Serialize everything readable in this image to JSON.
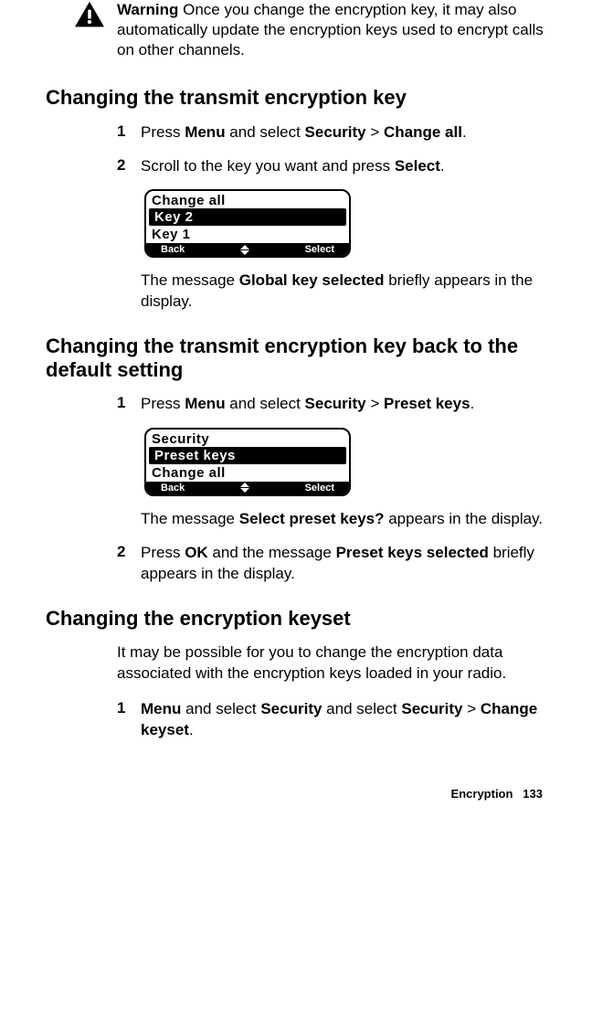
{
  "warning": {
    "label": "Warning",
    "text": "Once you change the encryption key, it may also automatically update the encryption keys used to encrypt calls on other channels."
  },
  "section1": {
    "heading": "Changing the transmit encryption key",
    "step1": {
      "num": "1",
      "prefix": "Press ",
      "b1": "Menu",
      "mid": " and select ",
      "b2": "Security",
      "sep": " > ",
      "b3": "Change all",
      "suffix": "."
    },
    "step2": {
      "num": "2",
      "prefix": "Scroll to the key you want and press ",
      "b1": "Select",
      "suffix": "."
    },
    "lcd": {
      "title": "Change all",
      "row_hi": "Key 2",
      "row2": "Key 1",
      "left": "Back",
      "right": "Select"
    },
    "result_pre": "The message ",
    "result_b": "Global key selected",
    "result_post": " briefly appears in the display."
  },
  "section2": {
    "heading": "Changing the transmit encryption key back to the default setting",
    "step1": {
      "num": "1",
      "prefix": "Press ",
      "b1": "Menu",
      "mid": " and select ",
      "b2": "Security",
      "sep": " > ",
      "b3": "Preset keys",
      "suffix": "."
    },
    "lcd": {
      "title": "Security",
      "row_hi": "Preset keys",
      "row2": "Change all",
      "left": "Back",
      "right": "Select"
    },
    "result_pre": "The message ",
    "result_b": "Select preset keys?",
    "result_post": " appears in the display.",
    "step2": {
      "num": "2",
      "prefix": "Press ",
      "b1": "OK",
      "mid": " and the message ",
      "b2": "Preset keys selected",
      "suffix": " briefly appears in the display."
    }
  },
  "section3": {
    "heading": "Changing the encryption keyset",
    "intro": "It may be possible for you to change the encryption data associated with the encryption keys loaded in your radio.",
    "step1": {
      "num": "1",
      "b1": "Menu",
      "mid1": " and select ",
      "b2": "Security",
      "mid2": " and select ",
      "b3": "Security",
      "sep": " > ",
      "b4": "Change keyset",
      "suffix": "."
    }
  },
  "footer": {
    "section": "Encryption",
    "page": "133"
  }
}
